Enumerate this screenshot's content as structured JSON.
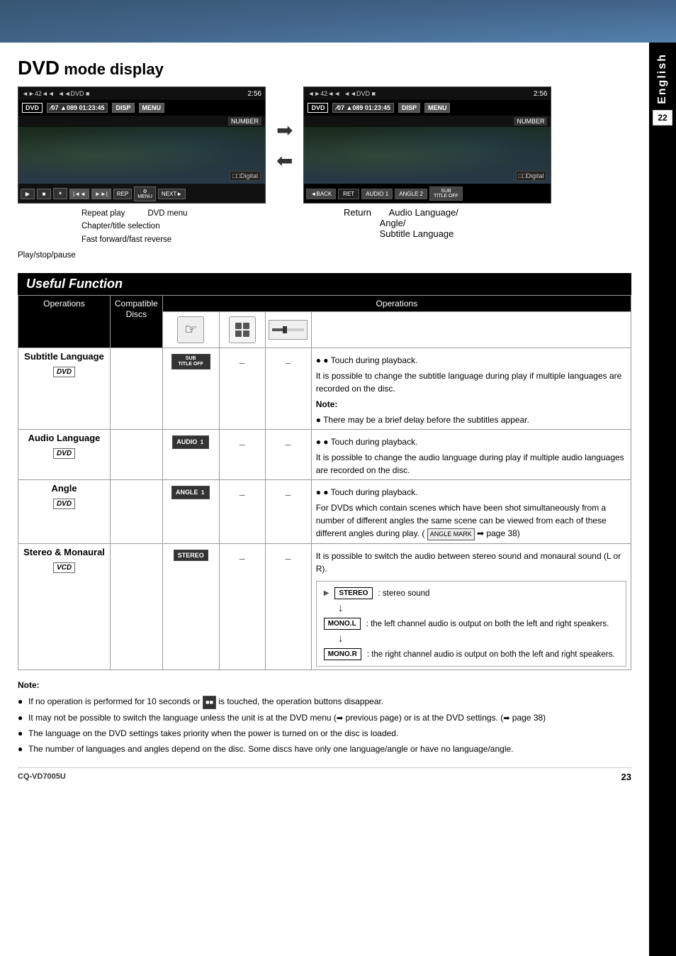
{
  "page": {
    "title": "DVD mode display",
    "dvd_big": "DVD",
    "mode_display": "mode display",
    "english_label": "English",
    "page_number": "22",
    "page_number_bottom": "23",
    "model": "CQ-VD7005U"
  },
  "screenshots": {
    "screen1": {
      "status_time": "2:56",
      "mode": "DVD",
      "chapter": "⁄07",
      "track": "▲089",
      "timecode": "01:23:45",
      "disp_btn": "DISP",
      "menu_btn": "MENU",
      "number_label": "NUMBER",
      "digital_label": "□□Digital"
    },
    "screen2": {
      "status_time": "2:56",
      "mode": "DVD",
      "chapter": "⁄07",
      "track": "▲089",
      "timecode": "01:23:45",
      "disp_btn": "DISP",
      "menu_btn": "MENU",
      "number_label": "NUMBER",
      "digital_label": "□□Digital",
      "back_btn": "◄BACK",
      "ret_btn": "RET",
      "audio_btn": "AUDIO 1",
      "angle_btn": "ANGLE 2",
      "sub_btn": "SUB TITLE OFF"
    }
  },
  "captions": {
    "play_stop": "Play/stop/pause",
    "repeat_play": "Repeat play",
    "dvd_menu": "DVD menu",
    "chapter_title": "Chapter/title selection",
    "fast_fwd_rev": "Fast forward/fast reverse",
    "return_label": "Return",
    "audio_lang_angle": "Audio Language/\nAngle/\nSubtitle Language"
  },
  "useful_function": {
    "title": "Useful Function",
    "operations_header": "Operations",
    "operations_col": "Operations",
    "compatible_discs_col": "Compatible\nDiscs",
    "rows": [
      {
        "id": "subtitle",
        "label": "Subtitle Language",
        "disc": "DVD",
        "icon_btn": "SUB TITLE OFF",
        "col2": "–",
        "col3": "–",
        "col4_touch": "● Touch during playback.",
        "desc": "It is possible to change the subtitle language during play if multiple languages are recorded on the disc.",
        "note_label": "Note:",
        "note": "● There may be a brief delay before the subtitles appear."
      },
      {
        "id": "audio",
        "label": "Audio Language",
        "disc": "DVD",
        "icon_btn": "AUDIO 1",
        "col2": "–",
        "col3": "–",
        "col4_touch": "● Touch during playback.",
        "desc": "It is possible to change the audio language during play if multiple audio languages are recorded on the disc."
      },
      {
        "id": "angle",
        "label": "Angle",
        "disc": "DVD",
        "icon_btn": "ANGLE 1",
        "col2": "–",
        "col3": "–",
        "col4_touch": "● Touch during playback.",
        "desc": "For DVDs which contain scenes which have been shot simultaneously from a number of different angles the same scene can be viewed from each of these different angles during play. (  ANGLE MARK  ➡ page 38)"
      },
      {
        "id": "stereo",
        "label": "Stereo & Monaural",
        "disc": "VCD",
        "icon_btn": "STEREO",
        "col2": "–",
        "col3": "–",
        "desc": "It is possible to switch the audio between stereo sound and monaural sound (L or R).",
        "stereo_items": [
          {
            "btn": "STEREO",
            "desc": ": stereo sound"
          },
          {
            "btn": "MONO.L",
            "desc": ": the left channel audio is output on both the left and right speakers."
          },
          {
            "btn": "MONO.R",
            "desc": ": the right channel audio is output on both the left and right speakers."
          }
        ]
      }
    ]
  },
  "notes": {
    "title": "Note:",
    "items": [
      "If no operation is performed for 10 seconds or  ■■  is touched, the operation buttons disappear.",
      "It may not be possible to switch the language unless the unit is at the DVD menu (➡ previous page) or is at the DVD settings. (➡ page 38)",
      "The language on the DVD settings takes priority when the power is turned on or the disc is loaded.",
      "The number of languages and angles depend on the disc. Some discs have only one language/angle or have no language/angle."
    ]
  }
}
